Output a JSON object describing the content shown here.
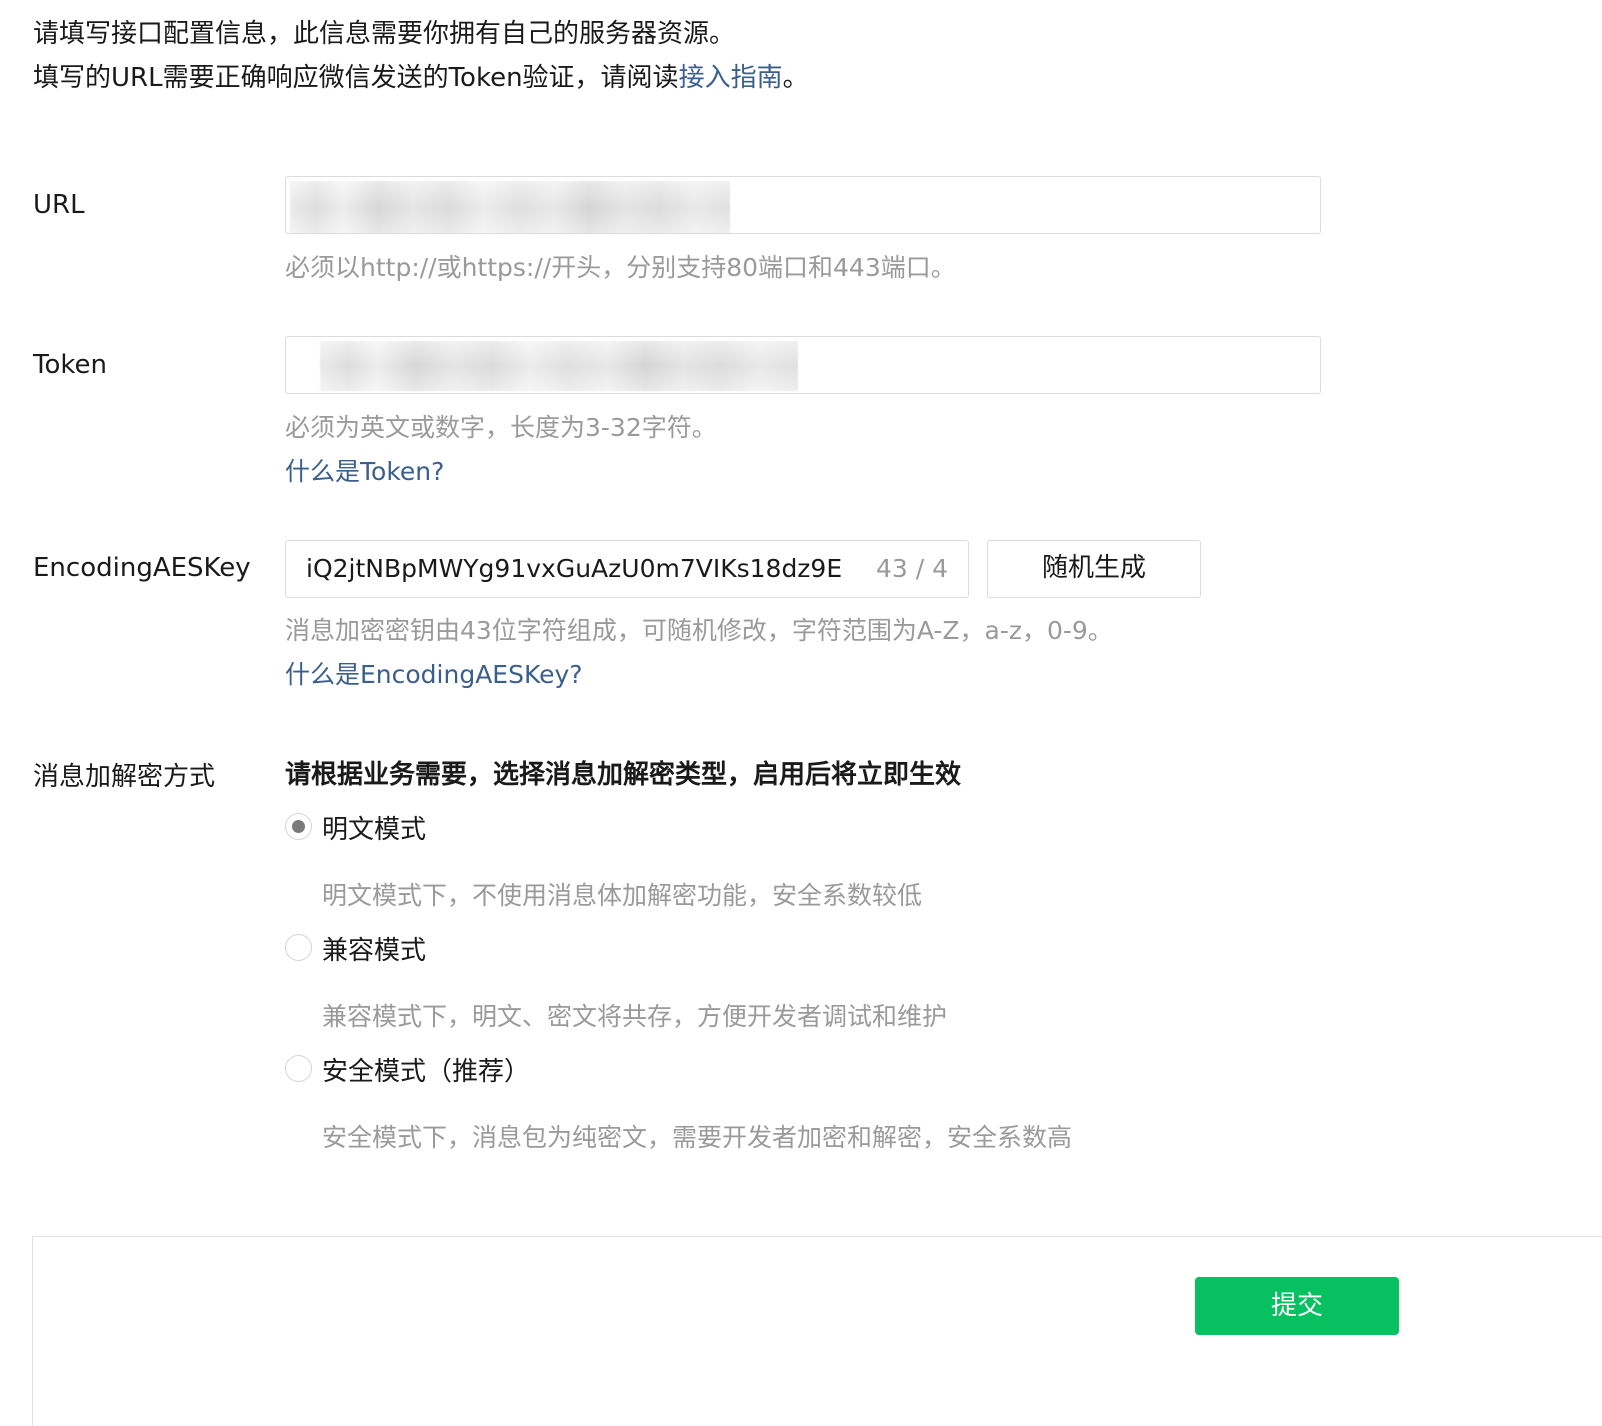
{
  "intro": {
    "line1": "请填写接口配置信息，此信息需要你拥有自己的服务器资源。",
    "line2_prefix": "填写的URL需要正确响应微信发送的Token验证，请阅读",
    "line2_link": "接入指南",
    "line2_suffix": "。"
  },
  "url": {
    "label": "URL",
    "hint": "必须以http://或https://开头，分别支持80端口和443端口。"
  },
  "token": {
    "label": "Token",
    "hint": "必须为英文或数字，长度为3-32字符。",
    "help_link": "什么是Token?"
  },
  "aes": {
    "label": "EncodingAESKey",
    "value": "iQ2jtNBpMWYg91vxGuAzU0m7VIKs18dz9E",
    "count": "43 / 4",
    "generate_button": "随机生成",
    "hint": "消息加密密钥由43位字符组成，可随机修改，字符范围为A-Z，a-z，0-9。",
    "help_link": "什么是EncodingAESKey?"
  },
  "encryption": {
    "label": "消息加解密方式",
    "title": "请根据业务需要，选择消息加解密类型，启用后将立即生效",
    "options": [
      {
        "label": "明文模式",
        "desc": "明文模式下，不使用消息体加解密功能，安全系数较低",
        "checked": true
      },
      {
        "label": "兼容模式",
        "desc": "兼容模式下，明文、密文将共存，方便开发者调试和维护",
        "checked": false
      },
      {
        "label": "安全模式（推荐）",
        "desc": "安全模式下，消息包为纯密文，需要开发者加密和解密，安全系数高",
        "checked": false
      }
    ]
  },
  "footer": {
    "submit": "提交"
  },
  "colors": {
    "link": "#3b5f8c",
    "primary_button": "#07c160",
    "hint": "#9a9a9a"
  }
}
